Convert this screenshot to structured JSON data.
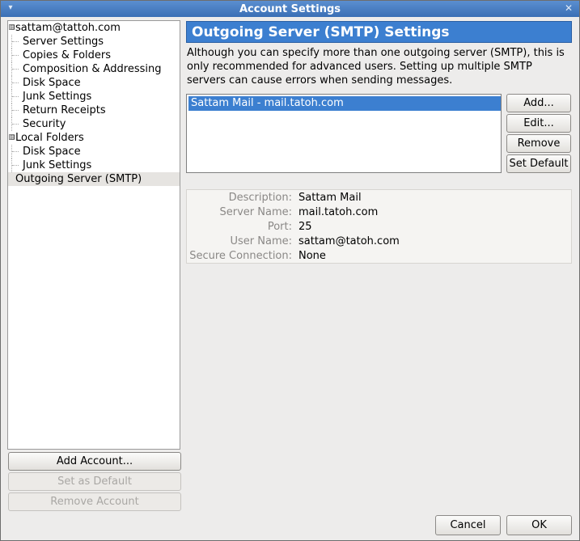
{
  "window": {
    "title": "Account Settings"
  },
  "tree": {
    "items": [
      {
        "label": "sattam@tattoh.com",
        "level": 0,
        "expander": "⊟"
      },
      {
        "label": "Server Settings",
        "level": 1
      },
      {
        "label": "Copies & Folders",
        "level": 1
      },
      {
        "label": "Composition & Addressing",
        "level": 1
      },
      {
        "label": "Disk Space",
        "level": 1
      },
      {
        "label": "Junk Settings",
        "level": 1
      },
      {
        "label": "Return Receipts",
        "level": 1
      },
      {
        "label": "Security",
        "level": 1
      },
      {
        "label": "Local Folders",
        "level": 0,
        "expander": "⊟"
      },
      {
        "label": "Disk Space",
        "level": 1
      },
      {
        "label": "Junk Settings",
        "level": 1
      },
      {
        "label": "Outgoing Server (SMTP)",
        "level": 0,
        "selected": true
      }
    ]
  },
  "left_buttons": {
    "add_account": "Add Account...",
    "set_default": "Set as Default",
    "remove_account": "Remove Account"
  },
  "panel": {
    "heading": "Outgoing Server (SMTP) Settings",
    "description": "Although you can specify more than one outgoing server (SMTP), this is only recommended for advanced users. Setting up multiple SMTP servers can cause errors when sending messages."
  },
  "server_list": {
    "items": [
      "Sattam Mail - mail.tatoh.com"
    ],
    "selected_index": 0
  },
  "server_buttons": {
    "add": "Add...",
    "edit": "Edit...",
    "remove": "Remove",
    "set_default": "Set Default"
  },
  "details": {
    "description_label": "Description:",
    "description_value": "Sattam Mail",
    "server_name_label": "Server Name:",
    "server_name_value": "mail.tatoh.com",
    "port_label": "Port:",
    "port_value": "25",
    "user_name_label": "User Name:",
    "user_name_value": "sattam@tatoh.com",
    "secure_label": "Secure Connection:",
    "secure_value": "None"
  },
  "dialog_buttons": {
    "cancel": "Cancel",
    "ok": "OK"
  },
  "colors": {
    "accent": "#3c7fd0",
    "titlebar": "#4a80c4"
  }
}
